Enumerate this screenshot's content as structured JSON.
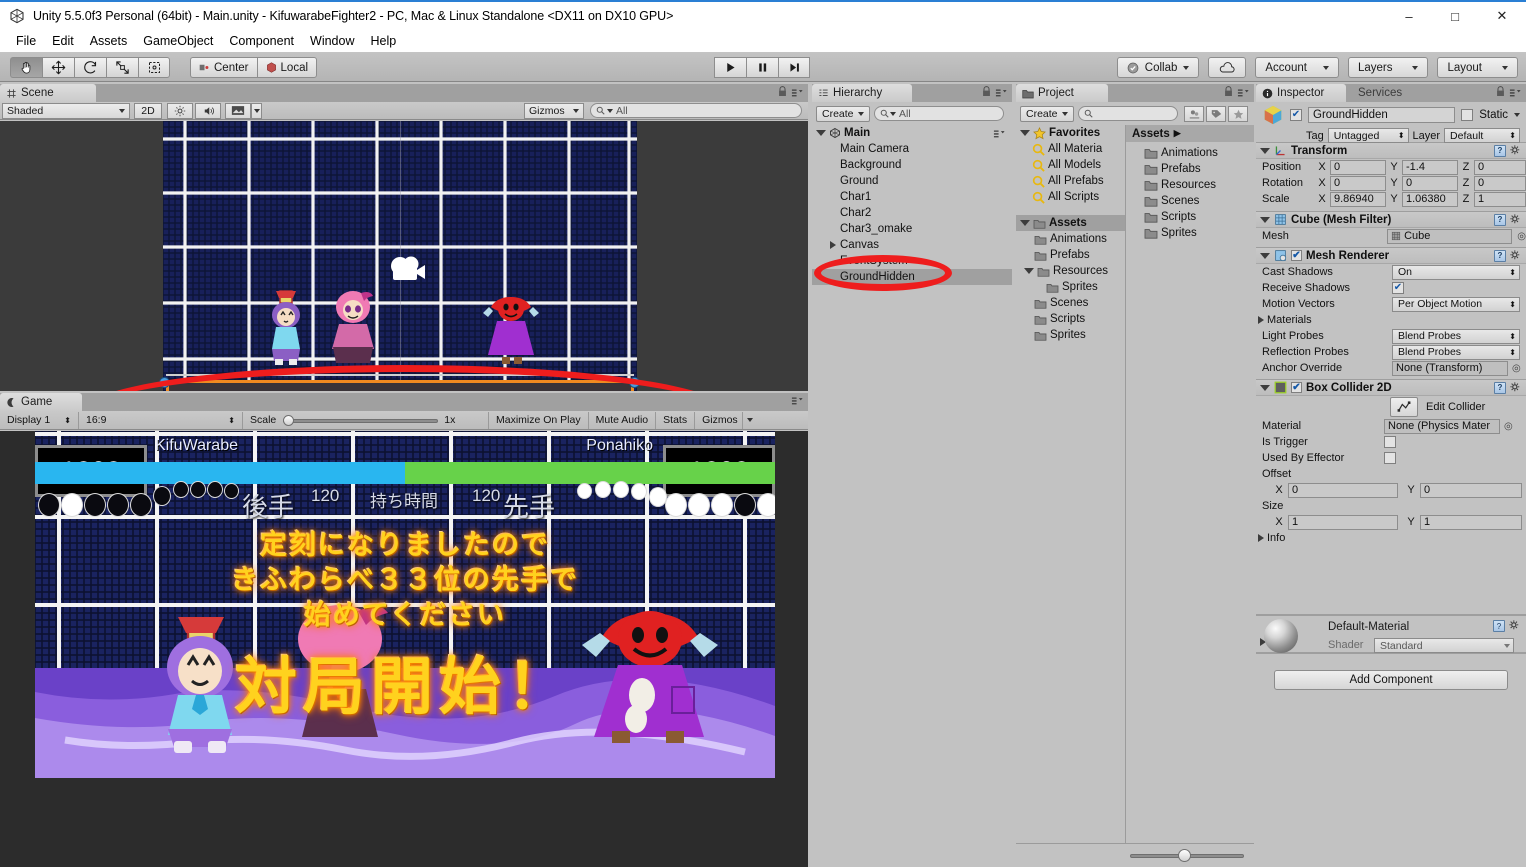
{
  "window": {
    "title": "Unity 5.5.0f3 Personal (64bit) - Main.unity - KifuwarabeFighter2 - PC, Mac & Linux Standalone <DX11 on DX10 GPU>",
    "minimize": "–",
    "maximize": "□",
    "close": "✕"
  },
  "menu": [
    "File",
    "Edit",
    "Assets",
    "GameObject",
    "Component",
    "Window",
    "Help"
  ],
  "toolbar": {
    "tools": [
      {
        "name": "hand-tool",
        "icon": "hand",
        "active": true
      },
      {
        "name": "move-tool",
        "icon": "move",
        "active": false
      },
      {
        "name": "rotate-tool",
        "icon": "rotate",
        "active": false
      },
      {
        "name": "scale-tool",
        "icon": "scale",
        "active": false
      },
      {
        "name": "rect-tool",
        "icon": "rect",
        "active": false
      }
    ],
    "pivot": "Center",
    "space": "Local",
    "play": "▶",
    "pause": "❚❚",
    "step": "▶❙",
    "collab": "Collab",
    "cloud": "cloud-icon",
    "account": "Account",
    "layers": "Layers",
    "layout": "Layout"
  },
  "scene": {
    "tab": "Scene",
    "draw_mode": "Shaded",
    "mode_2d": "2D",
    "gizmos": "Gizmos",
    "search_placeholder": "All",
    "toggles": [
      "lighting-icon",
      "audio-icon",
      "effects-icon"
    ]
  },
  "game": {
    "tab": "Game",
    "display": "Display 1",
    "aspect": "16:9",
    "scale_label": "Scale",
    "scale_value": "1x",
    "maximize_on_play": "Maximize On Play",
    "mute_audio": "Mute Audio",
    "stats": "Stats",
    "gizmos": "Gizmos",
    "hud": {
      "left_player": "KifuWarabe",
      "left_score": "1303",
      "right_player": "Ponahiko",
      "right_score": "1303",
      "left_side_label": "後手",
      "left_time": "120",
      "center_label": "持ち時間",
      "right_time": "120",
      "right_side_label": "先手",
      "left_bar_color": "#29b6f0",
      "right_bar_color": "#67d24a"
    },
    "message_lines": [
      "定刻になりましたので",
      "きふわらべ３３位の先手で",
      "始めてください"
    ],
    "big_message": "対局開始！"
  },
  "hierarchy": {
    "tab": "Hierarchy",
    "create": "Create",
    "search_placeholder": "All",
    "root": "Main",
    "items": [
      {
        "label": "Main Camera",
        "depth": 1,
        "expandable": false,
        "selected": false
      },
      {
        "label": "Background",
        "depth": 1,
        "expandable": false,
        "selected": false
      },
      {
        "label": "Ground",
        "depth": 1,
        "expandable": false,
        "selected": false
      },
      {
        "label": "Char1",
        "depth": 1,
        "expandable": false,
        "selected": false
      },
      {
        "label": "Char2",
        "depth": 1,
        "expandable": false,
        "selected": false
      },
      {
        "label": "Char3_omake",
        "depth": 1,
        "expandable": false,
        "selected": false
      },
      {
        "label": "Canvas",
        "depth": 1,
        "expandable": true,
        "selected": false
      },
      {
        "label": "EventSystem",
        "depth": 1,
        "expandable": false,
        "selected": false
      },
      {
        "label": "GroundHidden",
        "depth": 1,
        "expandable": false,
        "selected": true
      }
    ]
  },
  "project": {
    "tab": "Project",
    "create": "Create",
    "search_placeholder": "",
    "favorites_label": "Favorites",
    "favorites": [
      "All Materia",
      "All Models",
      "All Prefabs",
      "All Scripts"
    ],
    "assets_label": "Assets",
    "tree": [
      {
        "label": "Animations",
        "depth": 1,
        "expandable": false
      },
      {
        "label": "Prefabs",
        "depth": 1,
        "expandable": false
      },
      {
        "label": "Resources",
        "depth": 1,
        "expandable": true
      },
      {
        "label": "Sprites",
        "depth": 2,
        "expandable": false
      },
      {
        "label": "Scenes",
        "depth": 1,
        "expandable": false
      },
      {
        "label": "Scripts",
        "depth": 1,
        "expandable": false
      },
      {
        "label": "Sprites",
        "depth": 1,
        "expandable": false
      }
    ],
    "breadcrumb": "Assets",
    "contents": [
      "Animations",
      "Prefabs",
      "Resources",
      "Scenes",
      "Scripts",
      "Sprites"
    ]
  },
  "inspector": {
    "tab": "Inspector",
    "tab_services": "Services",
    "object_name": "GroundHidden",
    "enabled": true,
    "static_label": "Static",
    "static_checked": false,
    "tag_label": "Tag",
    "tag_value": "Untagged",
    "layer_label": "Layer",
    "layer_value": "Default",
    "transform": {
      "title": "Transform",
      "rows": [
        {
          "label": "Position",
          "x": "0",
          "y": "-1.4",
          "z": "0"
        },
        {
          "label": "Rotation",
          "x": "0",
          "y": "0",
          "z": "0"
        },
        {
          "label": "Scale",
          "x": "9.86940",
          "y": "1.06380",
          "z": "1"
        }
      ]
    },
    "mesh_filter": {
      "title": "Cube (Mesh Filter)",
      "mesh_label": "Mesh",
      "mesh_value": "Cube"
    },
    "mesh_renderer": {
      "title": "Mesh Renderer",
      "enabled": true,
      "cast_shadows_label": "Cast Shadows",
      "cast_shadows_value": "On",
      "receive_shadows_label": "Receive Shadows",
      "receive_shadows_checked": true,
      "motion_vectors_label": "Motion Vectors",
      "motion_vectors_value": "Per Object Motion",
      "materials_label": "Materials",
      "light_probes_label": "Light Probes",
      "light_probes_value": "Blend Probes",
      "reflection_probes_label": "Reflection Probes",
      "reflection_probes_value": "Blend Probes",
      "anchor_override_label": "Anchor Override",
      "anchor_override_value": "None (Transform)"
    },
    "box_collider_2d": {
      "title": "Box Collider 2D",
      "enabled": true,
      "edit_collider": "Edit Collider",
      "material_label": "Material",
      "material_value": "None (Physics Mater",
      "is_trigger_label": "Is Trigger",
      "is_trigger_checked": false,
      "used_by_effector_label": "Used By Effector",
      "used_by_effector_checked": false,
      "offset_label": "Offset",
      "offset_x": "0",
      "offset_y": "0",
      "size_label": "Size",
      "size_x": "1",
      "size_y": "1",
      "info_label": "Info"
    },
    "material": {
      "name": "Default-Material",
      "shader_label": "Shader",
      "shader_value": "Standard"
    },
    "add_component": "Add Component"
  }
}
